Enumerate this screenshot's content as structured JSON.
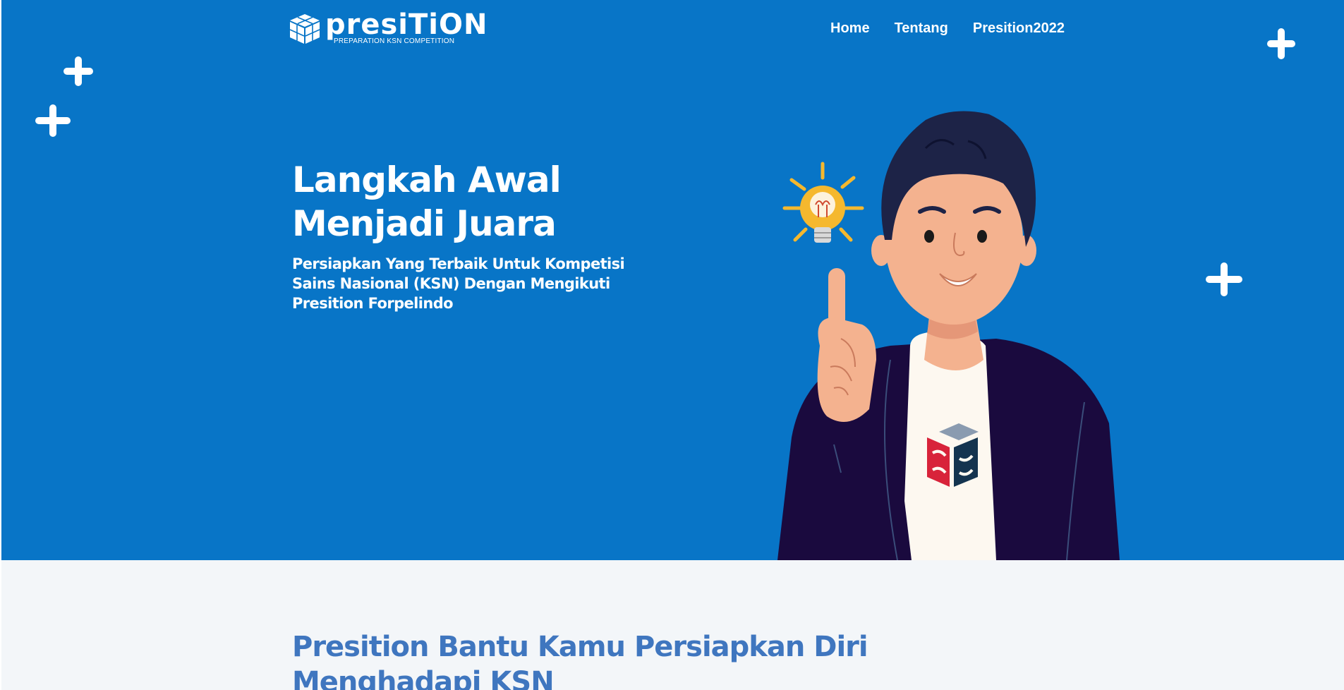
{
  "brand": {
    "name": "presiTiON",
    "tagline": "PREPARATION KSN COMPETITION",
    "colors": {
      "hero_bg": "#0875c7",
      "section_bg": "#f3f6f9",
      "heading_blue": "#3f76bf",
      "white": "#ffffff"
    }
  },
  "nav": {
    "items": [
      {
        "label": "Home"
      },
      {
        "label": "Tentang"
      },
      {
        "label": "Presition2022"
      }
    ]
  },
  "hero": {
    "headline_line1": "Langkah Awal",
    "headline_line2": "Menjadi Juara",
    "subline": "Persiapkan Yang Terbaik Untuk Kompetisi Sains Nasional (KSN) Dengan Mengikuti Presition Forpelindo"
  },
  "section2": {
    "title": "Presition Bantu Kamu Persiapkan Diri Menghadapi KSN"
  },
  "icons": {
    "logo": "cube-logo-icon",
    "decor": "plus-sparkle-icon",
    "illustration": "person-with-lightbulb-illustration"
  }
}
